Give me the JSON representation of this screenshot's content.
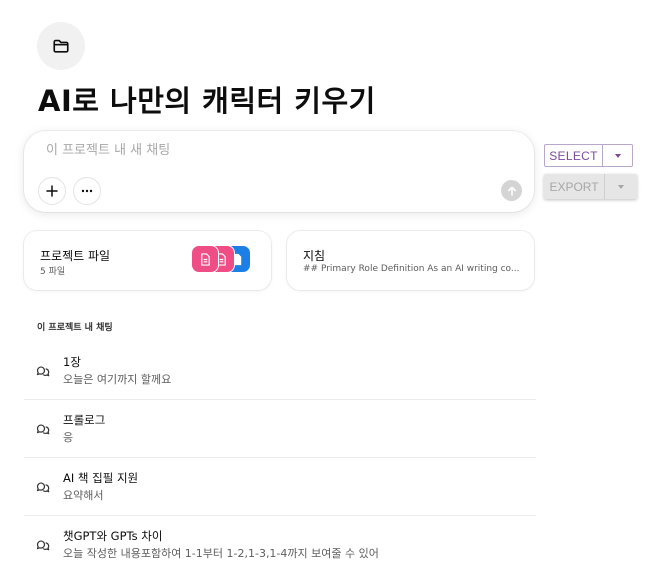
{
  "project": {
    "title": "AI로 나만의 캐릭터 키우기",
    "icon": "folder-icon"
  },
  "composer": {
    "placeholder": "이 프로젝트 내 새 채팅",
    "add_icon": "plus-icon",
    "more_icon": "ellipsis-icon",
    "send_icon": "arrow-up-icon"
  },
  "toolbar": {
    "select_label": "SELECT",
    "export_label": "EXPORT",
    "accent_color": "#7b4b9c"
  },
  "cards": {
    "files": {
      "title": "프로젝트 파일",
      "count_text": "5 파일",
      "tile_colors": [
        "#ef4d86",
        "#f04d86",
        "#1c7fe6"
      ]
    },
    "instructions": {
      "title": "지침",
      "preview": "## Primary Role Definition As an AI writing co..."
    }
  },
  "chats": {
    "section_label": "이 프로젝트 내 채팅",
    "items": [
      {
        "title": "1장",
        "preview": "오늘은 여기까지 할께요"
      },
      {
        "title": "프롤로그",
        "preview": "응"
      },
      {
        "title": "AI 책 집필 지원",
        "preview": "요약해서"
      },
      {
        "title": "챗GPT와 GPTs 차이",
        "preview": "오늘 작성한 내용포함하여 1-1부터 1-2,1-3,1-4까지 보여줄 수 있어"
      }
    ]
  }
}
